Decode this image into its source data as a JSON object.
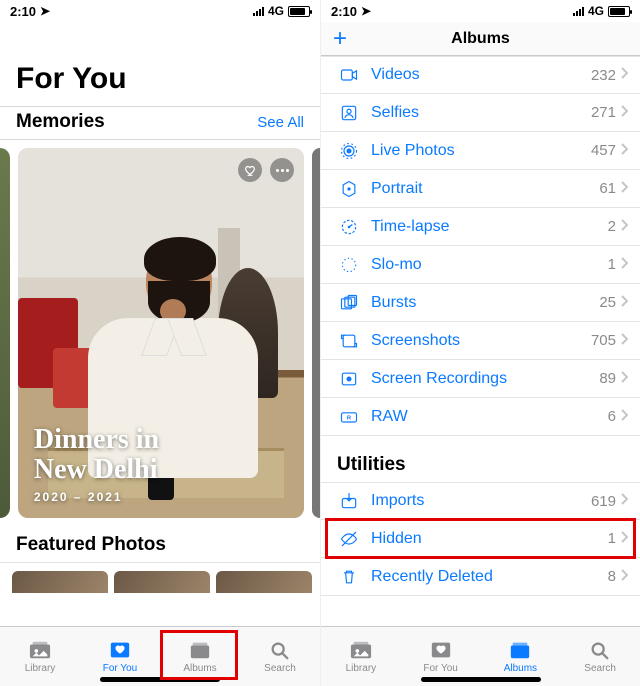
{
  "status": {
    "time": "2:10",
    "network": "4G"
  },
  "left": {
    "title": "For You",
    "memories_label": "Memories",
    "see_all": "See All",
    "memory": {
      "line1": "Dinners in",
      "line2": "New Delhi",
      "range": "2020 – 2021"
    },
    "featured_label": "Featured Photos"
  },
  "right": {
    "nav_title": "Albums",
    "media_types": [
      {
        "icon": "videos",
        "label": "Videos",
        "count": "232"
      },
      {
        "icon": "selfies",
        "label": "Selfies",
        "count": "271"
      },
      {
        "icon": "live",
        "label": "Live Photos",
        "count": "457"
      },
      {
        "icon": "portrait",
        "label": "Portrait",
        "count": "61"
      },
      {
        "icon": "timelapse",
        "label": "Time-lapse",
        "count": "2"
      },
      {
        "icon": "slomo",
        "label": "Slo-mo",
        "count": "1"
      },
      {
        "icon": "bursts",
        "label": "Bursts",
        "count": "25"
      },
      {
        "icon": "screenshots",
        "label": "Screenshots",
        "count": "705"
      },
      {
        "icon": "screenrec",
        "label": "Screen Recordings",
        "count": "89"
      },
      {
        "icon": "raw",
        "label": "RAW",
        "count": "6"
      }
    ],
    "utilities_label": "Utilities",
    "utilities": [
      {
        "icon": "imports",
        "label": "Imports",
        "count": "619"
      },
      {
        "icon": "hidden",
        "label": "Hidden",
        "count": "1",
        "highlight": true
      },
      {
        "icon": "trash",
        "label": "Recently Deleted",
        "count": "8"
      }
    ]
  },
  "tabs": {
    "library": "Library",
    "foryou": "For You",
    "albums": "Albums",
    "search": "Search"
  }
}
